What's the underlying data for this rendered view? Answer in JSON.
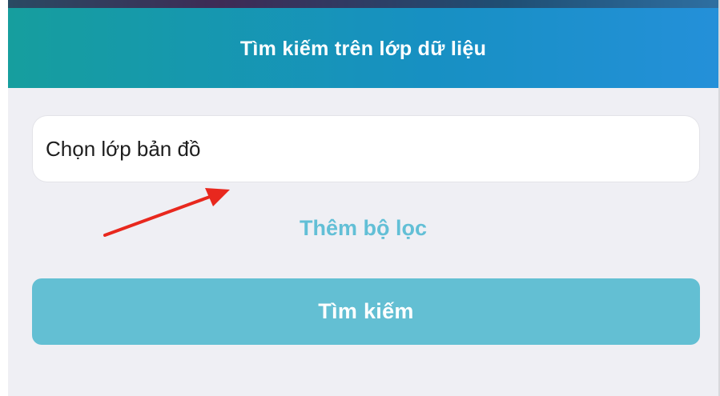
{
  "header": {
    "title": "Tìm kiếm trên lớp dữ liệu"
  },
  "layer_select": {
    "value": "Chọn lớp bản đồ"
  },
  "add_filter": {
    "label": "Thêm bộ lọc"
  },
  "search_button": {
    "label": "Tìm kiếm"
  },
  "colors": {
    "header_gradient_start": "#169e9e",
    "header_gradient_end": "#2490d9",
    "accent": "#63bfd3",
    "link": "#62bfd6",
    "background": "#efeff4",
    "annotation_arrow": "#e8281e"
  },
  "icons": {
    "annotation": "red-arrow-icon"
  }
}
